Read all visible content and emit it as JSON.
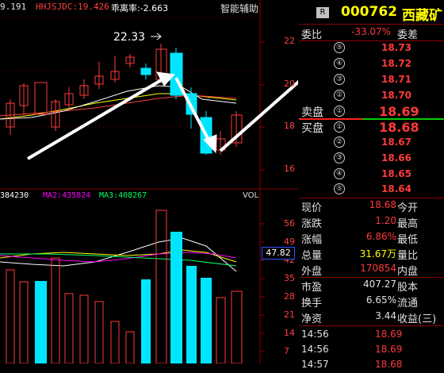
{
  "header": {
    "left_value": "9.191",
    "indicator_name": "HHJSJDC:19.426",
    "deviation": "乖离率:-2.663",
    "assist": "智能辅助"
  },
  "price_chart": {
    "peak_label": "22.33",
    "axis": [
      "22",
      "20",
      "18",
      "16"
    ]
  },
  "volume_chart": {
    "label": "VOL",
    "ma1": "384230",
    "ma2": "MA2:435824",
    "ma3": "MA3:408267",
    "axis": [
      "56",
      "49",
      "42",
      "35",
      "28",
      "21",
      "14",
      "7"
    ],
    "current": "47.82"
  },
  "stock": {
    "badge": "R",
    "code": "000762",
    "name": "西藏矿"
  },
  "order_book": {
    "weibi_label": "委比",
    "weibi_value": "-33.07%",
    "weicha_label": "委差",
    "sell_label": "卖盘",
    "buy_label": "买盘",
    "sells": [
      {
        "level": "⑤",
        "price": "18.73"
      },
      {
        "level": "④",
        "price": "18.72"
      },
      {
        "level": "③",
        "price": "18.71"
      },
      {
        "level": "②",
        "price": "18.70"
      },
      {
        "level": "①",
        "price": "18.69"
      }
    ],
    "buys": [
      {
        "level": "①",
        "price": "18.68"
      },
      {
        "level": "②",
        "price": "18.67"
      },
      {
        "level": "③",
        "price": "18.66"
      },
      {
        "level": "④",
        "price": "18.65"
      },
      {
        "level": "⑤",
        "price": "18.64"
      }
    ]
  },
  "quote": [
    {
      "l1": "现价",
      "v1": "18.68",
      "l2": "今开"
    },
    {
      "l1": "涨跌",
      "v1": "1.20",
      "l2": "最高"
    },
    {
      "l1": "涨幅",
      "v1": "6.86%",
      "l2": "最低"
    },
    {
      "l1": "总量",
      "v1": "31.67万",
      "l2": "量比"
    },
    {
      "l1": "外盘",
      "v1": "170854",
      "l2": "内盘"
    }
  ],
  "finance": [
    {
      "l1": "市盈",
      "v1": "407.27",
      "l2": "股本"
    },
    {
      "l1": "换手",
      "v1": "6.65%",
      "l2": "流通"
    },
    {
      "l1": "净资",
      "v1": "3.44",
      "l2": "收益(三)"
    }
  ],
  "ticks": [
    {
      "time": "14:56",
      "price": "18.69"
    },
    {
      "time": "14:56",
      "price": "18.69"
    },
    {
      "time": "14:57",
      "price": "18.68"
    }
  ],
  "colors": {
    "up": "#ff3a3a",
    "down": "#00e5ff",
    "ma1": "#ffffff",
    "ma2": "#ffff00",
    "ma3": "#ff00ff"
  }
}
